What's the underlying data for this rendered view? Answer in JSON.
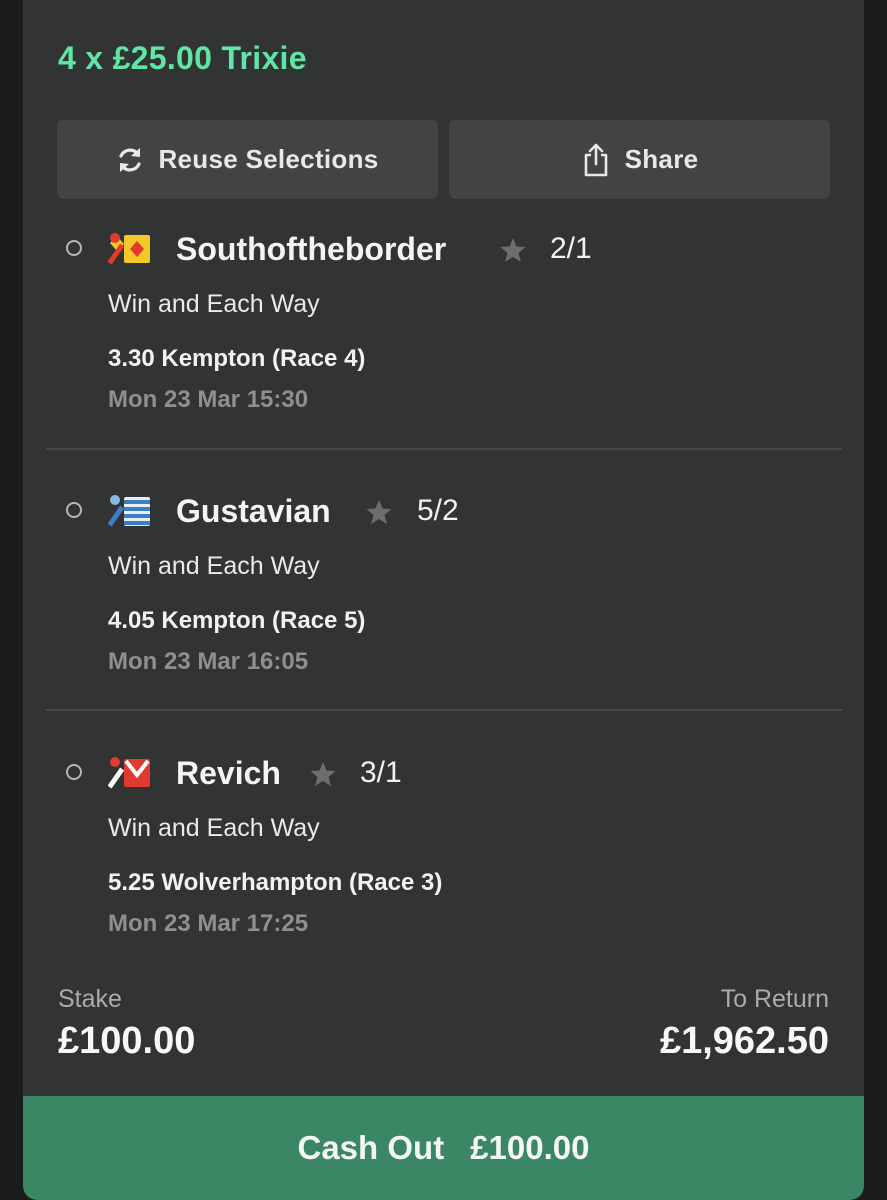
{
  "bet": {
    "title": "4 x £25.00 Trixie"
  },
  "actions": {
    "reuse_label": "Reuse Selections",
    "share_label": "Share"
  },
  "selections": [
    {
      "horse": "Southoftheborder",
      "odds": "2/1",
      "market": "Win and Each Way",
      "race": "3.30 Kempton (Race 4)",
      "datetime": "Mon 23 Mar 15:30",
      "silk_icon": "silk-yellow-red-diamonds-icon"
    },
    {
      "horse": "Gustavian",
      "odds": "5/2",
      "market": "Win and Each Way",
      "race": "4.05 Kempton (Race 5)",
      "datetime": "Mon 23 Mar 16:05",
      "silk_icon": "silk-blue-white-hoops-icon"
    },
    {
      "horse": "Revich",
      "odds": "3/1",
      "market": "Win and Each Way",
      "race": "5.25 Wolverhampton (Race 3)",
      "datetime": "Mon 23 Mar 17:25",
      "silk_icon": "silk-red-white-chevron-icon"
    }
  ],
  "summary": {
    "stake_label": "Stake",
    "stake_value": "£100.00",
    "return_label": "To Return",
    "return_value": "£1,962.50"
  },
  "cashout": {
    "label": "Cash Out",
    "amount": "£100.00"
  },
  "colors": {
    "accent": "#5fe6a7",
    "card_bg": "#323433",
    "cashout_bg": "#3b8664"
  }
}
